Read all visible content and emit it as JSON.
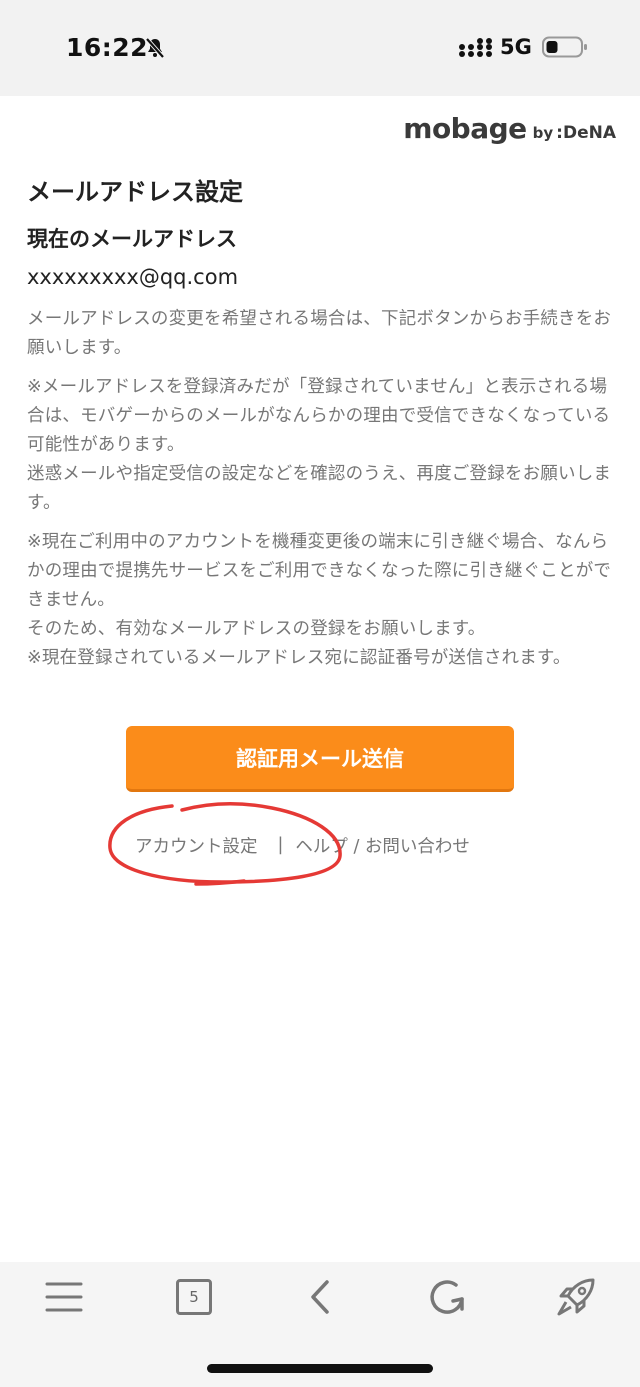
{
  "status_bar": {
    "time": "16:22",
    "network": "5G",
    "icons": [
      "bell-slash-icon",
      "signal-icon",
      "battery-icon"
    ]
  },
  "logo": {
    "main": "mobage",
    "by": "by",
    "brand": ":DeNA"
  },
  "page": {
    "title": "メールアドレス設定",
    "current_email_heading": "現在のメールアドレス",
    "current_email": "xxxxxxxxx@qq.com",
    "paragraph1": "メールアドレスの変更を希望される場合は、下記ボタンからお手続きをお願いします。",
    "paragraph2_lines": [
      "※メールアドレスを登録済みだが「登録されていません」と表示される場合は、モバゲーからのメールがなんらかの理由で受信できなくなっている可能性があります。",
      "迷惑メールや指定受信の設定などを確認のうえ、再度ご登録をお願いします。"
    ],
    "paragraph3_lines": [
      "※現在ご利用中のアカウントを機種変更後の端末に引き継ぐ場合、なんらかの理由で提携先サービスをご利用できなくなった際に引き継ぐことができません。",
      "そのため、有効なメールアドレスの登録をお願いします。",
      "※現在登録されているメールアドレス宛に認証番号が送信されます。"
    ],
    "send_button_label": "認証用メール送信",
    "account_settings_label": "アカウント設定",
    "separator": "|",
    "help_label": "ヘルプ / お問い合わせ"
  },
  "annotation": {
    "color": "#e53935"
  },
  "bottom_bar": {
    "tab_count": "5",
    "icons": [
      "menu-icon",
      "tabs-icon",
      "back-icon",
      "reload-icon",
      "rocket-icon"
    ]
  },
  "colors": {
    "accent": "#fb8c1a",
    "text_muted": "#777777",
    "status_bar_bg": "#f2f2f2"
  }
}
